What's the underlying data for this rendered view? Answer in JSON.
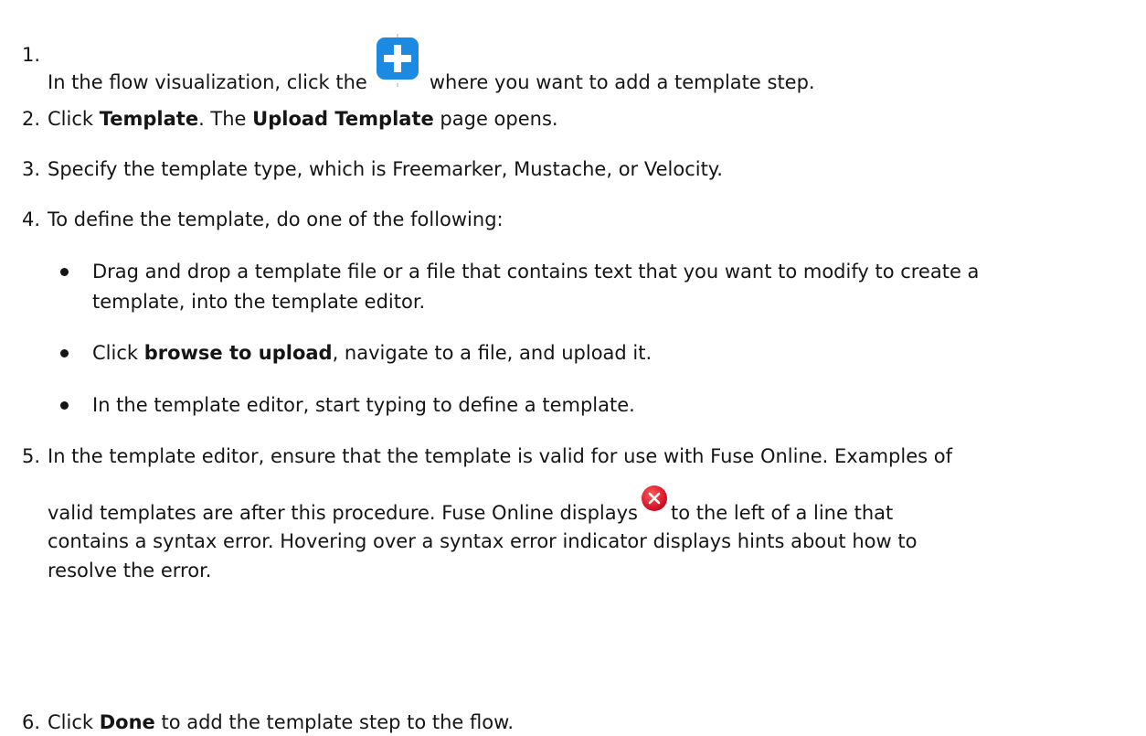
{
  "steps": [
    {
      "number": "1.",
      "before": "In the flow visualization, click the",
      "after": "where you want to add a template step."
    },
    {
      "number": "2.",
      "p1": "Click ",
      "b1": "Template",
      "p2": ". The ",
      "b2": "Upload Template",
      "p3": " page opens."
    },
    {
      "number": "3.",
      "text": "Specify the template type, which is Freemarker, Mustache, or Velocity."
    },
    {
      "number": "4.",
      "text": "To define the template, do one of the following:",
      "bullets": [
        {
          "line1": "Drag and drop a template file or a file that contains text that you want to modify to create a",
          "line2": "template, into the template editor."
        },
        {
          "p1": "Click ",
          "b1": "browse to upload",
          "p2": ", navigate to a file, and upload it."
        },
        {
          "text": "In the template editor, start typing to define a template."
        }
      ]
    },
    {
      "number": "5.",
      "line1": "In the template editor, ensure that the template is valid for use with Fuse Online. Examples of",
      "line2_before": "valid templates are after this procedure. Fuse Online displays",
      "line2_after": "to the left of a line that",
      "line3": "contains a syntax error. Hovering over a syntax error indicator displays hints about how to",
      "line4": "resolve the error."
    },
    {
      "number": "6.",
      "p1": "Click ",
      "b1": "Done",
      "p2": " to add the template step to the flow."
    }
  ],
  "icons": {
    "plus": "plus-icon",
    "error": "error-indicator-icon"
  },
  "colors": {
    "plus_blue": "#1b8ae0",
    "error_red": "#d0021b",
    "text": "#151515"
  }
}
